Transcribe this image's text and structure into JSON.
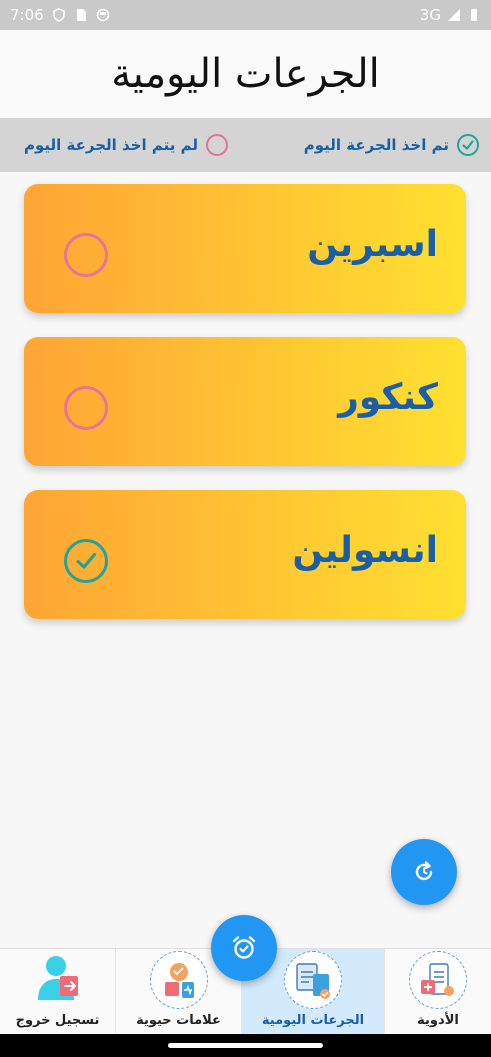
{
  "status_bar": {
    "time": "7:06",
    "network": "3G",
    "icons": [
      "shield-icon",
      "sim-icon",
      "circle-app-icon",
      "signal-icon",
      "battery-icon"
    ]
  },
  "header": {
    "title": "الجرعات اليومية"
  },
  "legend": {
    "taken_label": "تم اخذ الجرعة اليوم",
    "not_taken_label": "لم يتم اخذ الجرعة اليوم"
  },
  "doses": [
    {
      "name": "اسبرين",
      "taken": false
    },
    {
      "name": "كنكور",
      "taken": false
    },
    {
      "name": "انسولين",
      "taken": true
    }
  ],
  "bottom_nav": {
    "items": [
      {
        "label": "تسجيل خروج",
        "icon": "logout-icon",
        "active": false
      },
      {
        "label": "علامات حيوية",
        "icon": "vital-signs-icon",
        "active": false
      },
      {
        "label": "الجرعات اليومية",
        "icon": "daily-doses-icon",
        "active": true
      },
      {
        "label": "الأدوية",
        "icon": "medicines-icon",
        "active": false
      }
    ]
  },
  "colors": {
    "accent": "#2196f3",
    "text_blue": "#1a5fa6",
    "taken": "#22a39a",
    "not_taken": "#e77396",
    "card_start": "#ffa535",
    "card_end": "#ffe030"
  }
}
